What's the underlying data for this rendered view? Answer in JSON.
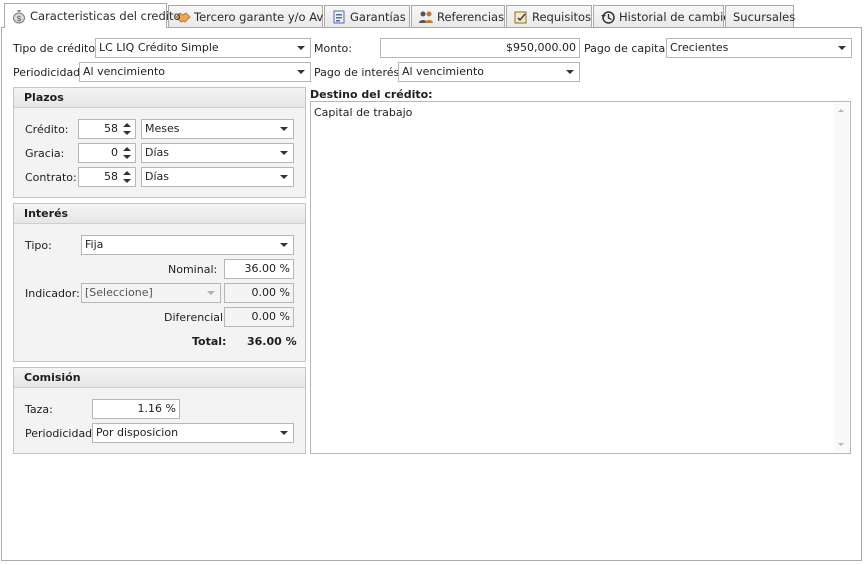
{
  "tabs": [
    {
      "label": "Caracteristicas del credito",
      "icon": "money-bag-icon",
      "active": true
    },
    {
      "label": "Tercero garante y/o Aval",
      "icon": "handshake-icon",
      "active": false
    },
    {
      "label": "Garantías",
      "icon": "guarantees-icon",
      "active": false
    },
    {
      "label": "Referencias",
      "icon": "people-icon",
      "active": false
    },
    {
      "label": "Requisitos",
      "icon": "checklist-icon",
      "active": false
    },
    {
      "label": "Historial de cambios",
      "icon": "history-icon",
      "active": false
    },
    {
      "label": "Sucursales",
      "icon": "",
      "active": false
    }
  ],
  "general": {
    "tipo_credito_label": "Tipo de crédito:",
    "tipo_credito_value": "LC LIQ Crédito Simple",
    "monto_label": "Monto:",
    "monto_value": "$950,000.00",
    "pago_capital_label": "Pago de capital:",
    "pago_capital_value": "Crecientes",
    "periodicidad_label": "Periodicidad:",
    "periodicidad_value": "Al vencimiento",
    "pago_interes_label": "Pago de interés:",
    "pago_interes_value": "Al vencimiento"
  },
  "plazos": {
    "title": "Plazos",
    "credito_label": "Crédito:",
    "credito_value": "58",
    "credito_unit": "Meses",
    "gracia_label": "Gracia:",
    "gracia_value": "0",
    "gracia_unit": "Días",
    "contrato_label": "Contrato:",
    "contrato_value": "58",
    "contrato_unit": "Días"
  },
  "interes": {
    "title": "Interés",
    "tipo_label": "Tipo:",
    "tipo_value": "Fija",
    "nominal_label": "Nominal:",
    "nominal_value": "36.00 %",
    "indicador_label": "Indicador:",
    "indicador_value": "[Seleccione]",
    "indicador_pct": "0.00 %",
    "diferencial_label": "Diferencial:",
    "diferencial_value": "0.00 %",
    "total_label": "Total:",
    "total_value": "36.00 %"
  },
  "comision": {
    "title": "Comisión",
    "taza_label": "Taza:",
    "taza_value": "1.16 %",
    "periodicidad_label": "Periodicidad:",
    "periodicidad_value": "Por disposicion"
  },
  "destino": {
    "label": "Destino del crédito:",
    "value": "Capital de trabajo"
  }
}
